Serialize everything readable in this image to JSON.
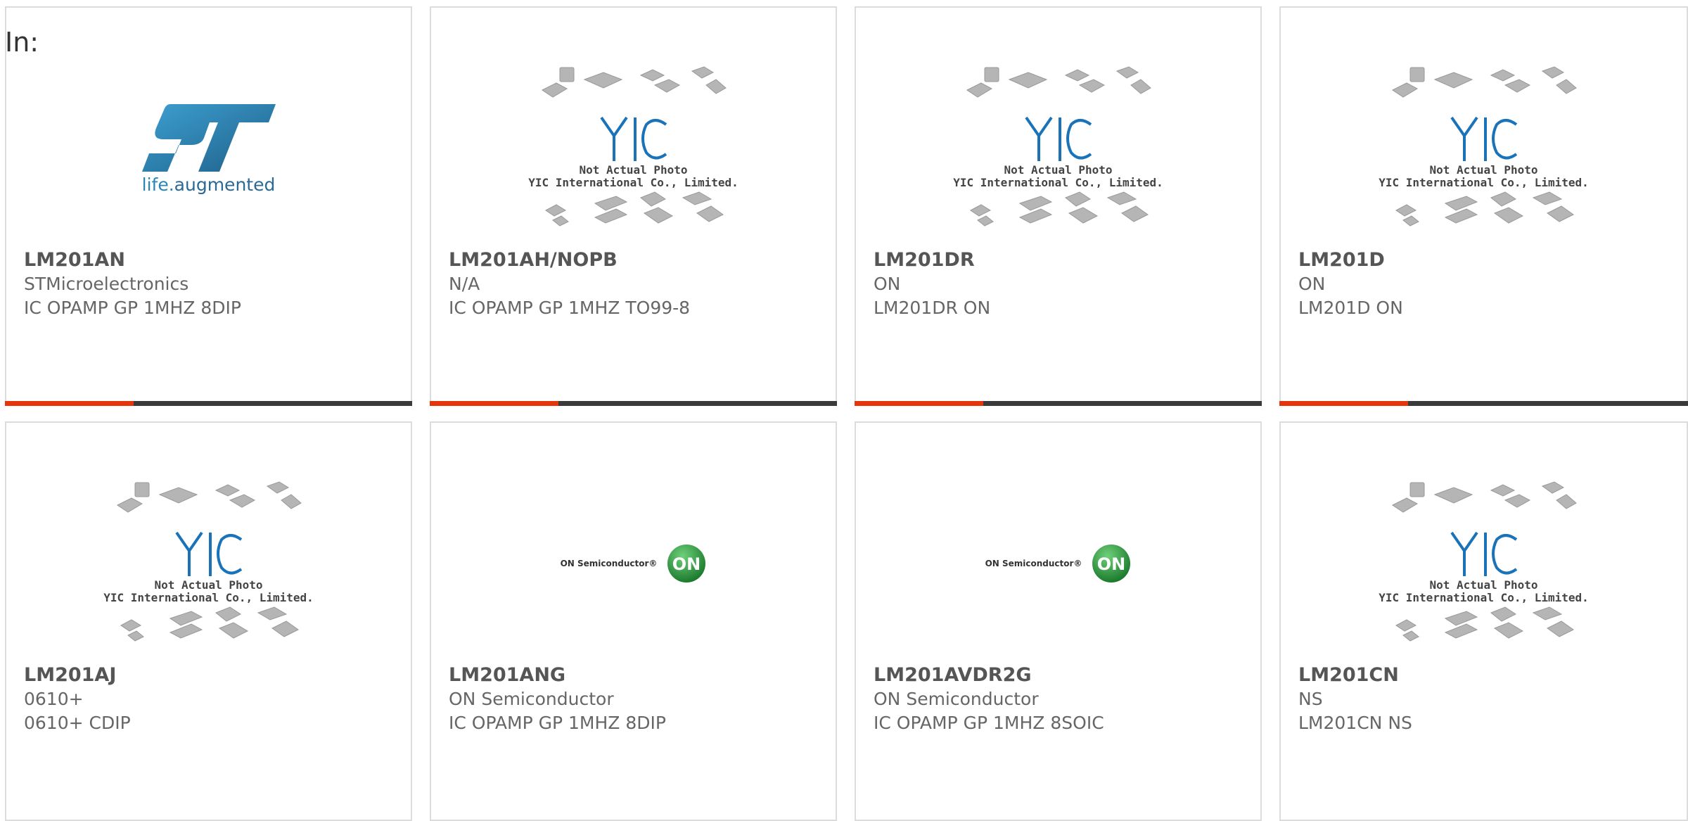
{
  "header": {
    "label": "In:"
  },
  "colors": {
    "accent": "#e5350a",
    "bar_dark": "#3a3a3a",
    "border": "#dcdcdc",
    "text": "#666666"
  },
  "placeholder_image": {
    "icon": "component-packages-placeholder-icon",
    "caption_line1": "Not Actual Photo",
    "caption_line2": "YIC International Co., Limited."
  },
  "logos": {
    "st_tagline_a": "life.",
    "st_tagline_b": "augmented",
    "on_wordmark": "ON Semiconductor®",
    "on_badge": "ON"
  },
  "products": [
    {
      "part": "LM201AN",
      "maker": "STMicroelectronics",
      "desc": "IC OPAMP GP 1MHZ 8DIP",
      "image": "st-logo"
    },
    {
      "part": "LM201AH/NOPB",
      "maker": "N/A",
      "desc": "IC OPAMP GP 1MHZ TO99-8",
      "image": "yic-placeholder"
    },
    {
      "part": "LM201DR",
      "maker": "ON",
      "desc": "LM201DR ON",
      "image": "yic-placeholder"
    },
    {
      "part": "LM201D",
      "maker": "ON",
      "desc": "LM201D ON",
      "image": "yic-placeholder"
    },
    {
      "part": "LM201AJ",
      "maker": "0610+",
      "desc": "0610+ CDIP",
      "image": "yic-placeholder"
    },
    {
      "part": "LM201ANG",
      "maker": "ON Semiconductor",
      "desc": "IC OPAMP GP 1MHZ 8DIP",
      "image": "on-logo"
    },
    {
      "part": "LM201AVDR2G",
      "maker": "ON Semiconductor",
      "desc": "IC OPAMP GP 1MHZ 8SOIC",
      "image": "on-logo"
    },
    {
      "part": "LM201CN",
      "maker": "NS",
      "desc": "LM201CN NS",
      "image": "yic-placeholder"
    }
  ]
}
